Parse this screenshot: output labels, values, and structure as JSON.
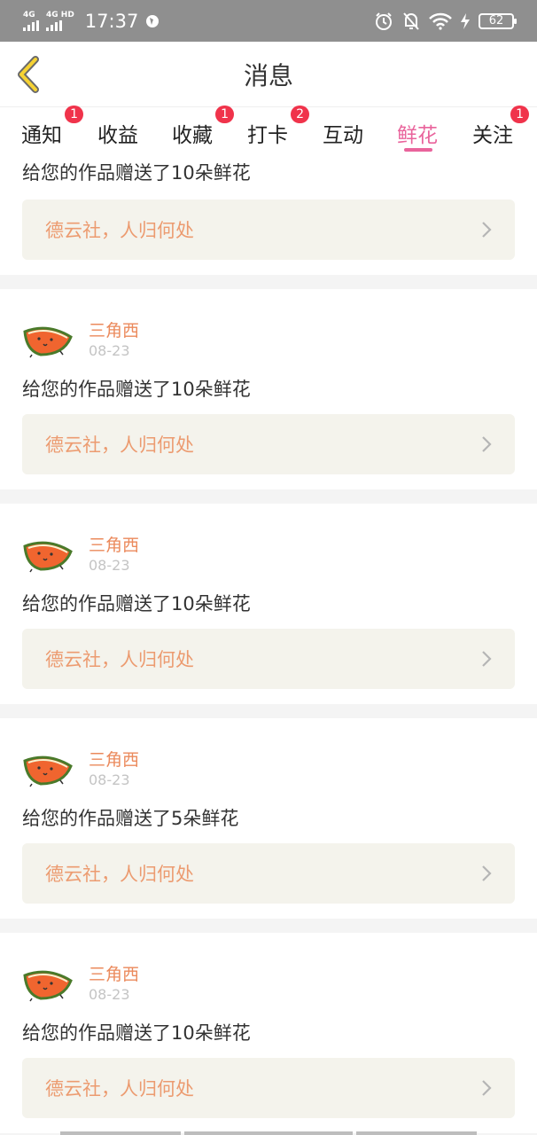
{
  "status_bar": {
    "signal1_label": "4G",
    "signal2_label": "4G HD",
    "time": "17:37",
    "battery": "62",
    "icons": [
      "location-icon",
      "alarm-icon",
      "bell-off-icon",
      "wifi-icon",
      "charging-icon"
    ]
  },
  "header": {
    "title": "消息",
    "back_icon": "chevron-left-icon"
  },
  "tabs": [
    {
      "label": "通知",
      "badge": "1"
    },
    {
      "label": "收益",
      "badge": ""
    },
    {
      "label": "收藏",
      "badge": "1"
    },
    {
      "label": "打卡",
      "badge": "2"
    },
    {
      "label": "互动",
      "badge": ""
    },
    {
      "label": "鲜花",
      "badge": "",
      "active": true
    },
    {
      "label": "关注",
      "badge": "1"
    }
  ],
  "top_item": {
    "text": "给您的作品赠送了10朵鲜花",
    "work_title": "德云社，人归何处"
  },
  "items": [
    {
      "user": "三角西",
      "date": "08-23",
      "text": "给您的作品赠送了10朵鲜花",
      "work_title": "德云社，人归何处"
    },
    {
      "user": "三角西",
      "date": "08-23",
      "text": "给您的作品赠送了10朵鲜花",
      "work_title": "德云社，人归何处"
    },
    {
      "user": "三角西",
      "date": "08-23",
      "text": "给您的作品赠送了5朵鲜花",
      "work_title": "德云社，人归何处"
    },
    {
      "user": "三角西",
      "date": "08-23",
      "text": "给您的作品赠送了10朵鲜花",
      "work_title": "德云社，人归何处"
    }
  ],
  "colors": {
    "accent": "#e9649c",
    "badge": "#f0334b",
    "username": "#eb8a5c",
    "work_title": "#ec9b70",
    "link_bg": "#f4f3ec"
  }
}
